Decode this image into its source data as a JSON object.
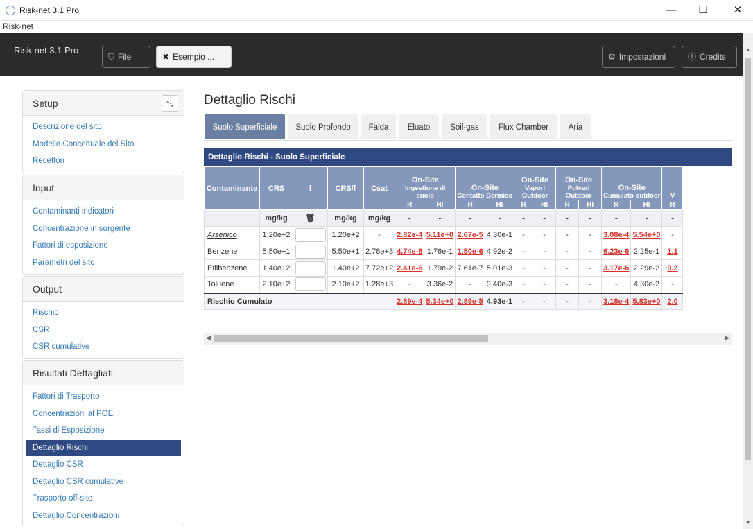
{
  "window": {
    "title": "Risk-net 3.1 Pro",
    "minimize": "—",
    "maximize": "☐",
    "close": "✕"
  },
  "menubar": {
    "label": "Risk-net"
  },
  "navbar": {
    "brand": "Risk-net 3.1 Pro",
    "file_label": "File",
    "esempio_label": "Esempio ...",
    "impostazioni_label": "Impostazioni",
    "credits_label": "Credits"
  },
  "sidebar": {
    "setup": {
      "title": "Setup",
      "items": [
        "Descrizione del sito",
        "Modello Concettuale del Sito",
        "Recettori"
      ]
    },
    "input": {
      "title": "Input",
      "items": [
        "Contaminanti indicatori",
        "Concentrazione in sorgente",
        "Fattori di esposizione",
        "Parametri del sito"
      ]
    },
    "output": {
      "title": "Output",
      "items": [
        "Rischio",
        "CSR",
        "CSR cumulative"
      ]
    },
    "risultati": {
      "title": "Risultati Dettagliati",
      "items": [
        "Fattori di Trasporto",
        "Concentrazioni al POE",
        "Tassi di Esposizione",
        "Dettaglio Rischi",
        "Dettaglio CSR",
        "Dettaglio CSR cumulative",
        "Trasporto off-site",
        "Dettaglio Concentrazioni"
      ],
      "selected": "Dettaglio Rischi"
    }
  },
  "main": {
    "title": "Dettaglio Rischi",
    "tabs": [
      "Suolo Superficiale",
      "Suolo Profondo",
      "Falda",
      "Eluato",
      "Soil-gas",
      "Flux Chamber",
      "Aria"
    ],
    "active_tab": "Suolo Superficiale",
    "table": {
      "caption": "Dettaglio Rischi - Suolo Superficiale",
      "headers": {
        "contaminante": "Contaminante",
        "crs": "CRS",
        "f": "f",
        "crsf": "CRS/f",
        "csat": "Csat"
      },
      "groups": [
        {
          "top": "On-Site",
          "sub": "Ingestione di suolo"
        },
        {
          "top": "On-Site",
          "sub": "Contatto Dermico"
        },
        {
          "top": "On-Site",
          "sub": "Vapori Outdoor"
        },
        {
          "top": "On-Site",
          "sub": "Polveri Outdoor"
        },
        {
          "top": "On-Site",
          "sub": "Cumulato outdoor"
        },
        {
          "top": "",
          "sub": "V"
        }
      ],
      "sub_r": "R",
      "sub_hi": "HI",
      "units": [
        "mg/kg",
        "",
        "mg/kg",
        "mg/kg",
        "-",
        "-",
        "-",
        "-",
        "-",
        "-",
        "-",
        "-",
        "-",
        "-",
        "-"
      ],
      "rows": [
        {
          "name": "Arsenico",
          "crs": "1.20e+2",
          "crsf": "1.20e+2",
          "csat": "-",
          "vals": [
            "2.82e-4",
            "5.11e+0",
            "2.67e-5",
            "4.30e-1",
            "-",
            "-",
            "-",
            "-",
            "3.08e-4",
            "5.54e+0",
            "-"
          ],
          "red": [
            0,
            1,
            2,
            8,
            9
          ]
        },
        {
          "name": "Benzene",
          "crs": "5.50e+1",
          "crsf": "5.50e+1",
          "csat": "2.78e+3",
          "vals": [
            "4.74e-6",
            "1.76e-1",
            "1.50e-6",
            "4.92e-2",
            "-",
            "-",
            "-",
            "-",
            "6.23e-6",
            "2.25e-1",
            "1.1"
          ],
          "red": [
            0,
            2,
            8,
            10
          ]
        },
        {
          "name": "Etilbenzene",
          "crs": "1.40e+2",
          "crsf": "1.40e+2",
          "csat": "7.72e+2",
          "vals": [
            "2.41e-6",
            "1.79e-2",
            "7.61e-7",
            "5.01e-3",
            "-",
            "-",
            "-",
            "-",
            "3.17e-6",
            "2.29e-2",
            "9.2"
          ],
          "red": [
            0,
            8,
            10
          ]
        },
        {
          "name": "Toluene",
          "crs": "2.10e+2",
          "crsf": "2.10e+2",
          "csat": "1.28e+3",
          "vals": [
            "-",
            "3.36e-2",
            "-",
            "9.40e-3",
            "-",
            "-",
            "-",
            "-",
            "-",
            "4.30e-2",
            "-"
          ],
          "red": []
        }
      ],
      "total": {
        "label": "Rischio Cumulato",
        "vals": [
          "2.89e-4",
          "5.34e+0",
          "2.89e-5",
          "4.93e-1",
          "-",
          "-",
          "-",
          "-",
          "3.18e-4",
          "5.83e+0",
          "2.0"
        ],
        "red": [
          0,
          1,
          2,
          8,
          9,
          10
        ]
      }
    }
  }
}
